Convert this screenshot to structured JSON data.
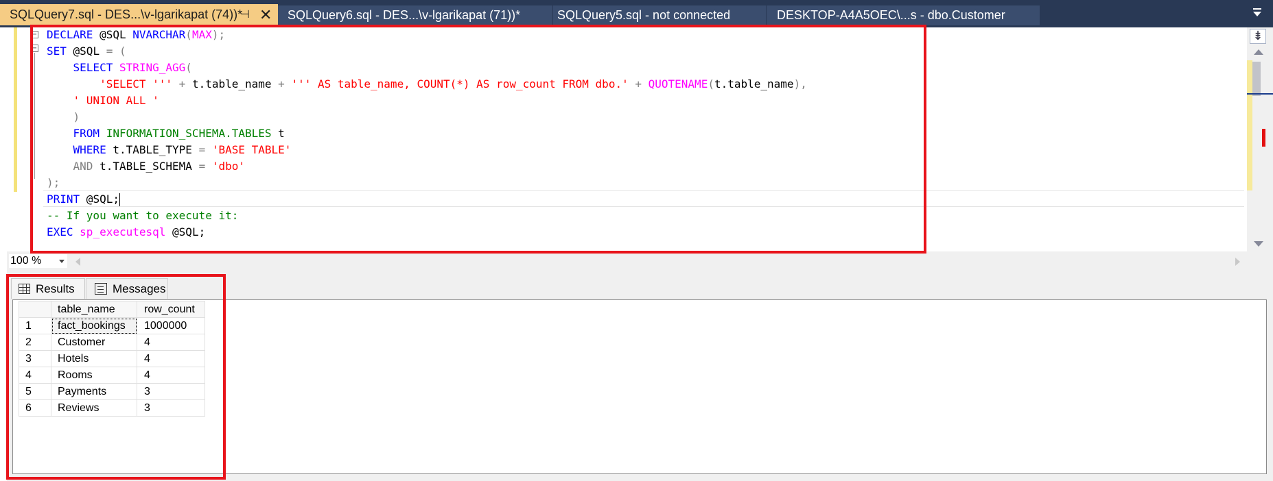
{
  "tabs": [
    {
      "label": "SQLQuery7.sql - DES...\\v-lgarikapat (74))*",
      "active": true
    },
    {
      "label": "SQLQuery6.sql - DES...\\v-lgarikapat (71))*",
      "active": false
    },
    {
      "label": "SQLQuery5.sql - not connected",
      "active": false
    },
    {
      "label": "DESKTOP-A4A5OEC\\...s - dbo.Customer",
      "active": false
    }
  ],
  "tab_icons": {
    "pin": "pin-icon",
    "close": "close-icon",
    "overflow": "tab-overflow-dropdown-icon"
  },
  "editor": {
    "lines": {
      "l1": {
        "kw1": "DECLARE",
        "var": " @SQL ",
        "kw2": "NVARCHAR",
        "p1": "(",
        "fn": "MAX",
        "p2": ");"
      },
      "l2": {
        "kw": "SET",
        "rest": " @SQL ",
        "op": "= ("
      },
      "l3": {
        "indent": "    ",
        "kw": "SELECT",
        "sp": " ",
        "fn": "STRING_AGG",
        "p": "("
      },
      "l4": {
        "indent": "        ",
        "s1": "'SELECT '''",
        "op1": " + ",
        "ident": "t.table_name",
        "op2": " + ",
        "s2": "''' AS table_name, COUNT(*) AS row_count FROM dbo.'",
        "op3": " + ",
        "fn": "QUOTENAME",
        "p1": "(",
        "arg": "t.table_name",
        "p2": "),"
      },
      "l5": {
        "indent": "    ",
        "s": "' UNION ALL '"
      },
      "l6": {
        "indent": "    ",
        "p": ")"
      },
      "l7": {
        "indent": "    ",
        "kw": "FROM",
        "sp": " ",
        "sys": "INFORMATION_SCHEMA.TABLES",
        "rest": " t"
      },
      "l8": {
        "indent": "    ",
        "kw": "WHERE",
        "rest": " t.TABLE_TYPE ",
        "op": "=",
        "sp": " ",
        "s": "'BASE TABLE'"
      },
      "l9": {
        "indent": "    ",
        "kw": "AND",
        "rest": " t.TABLE_SCHEMA ",
        "op": "=",
        "sp": " ",
        "s": "'dbo'"
      },
      "l10": {
        "p": ");"
      },
      "l11": {
        "kw": "PRINT",
        "rest": " @SQL;"
      },
      "l12": {
        "cmt": "-- If you want to execute it:"
      },
      "l13": {
        "kw": "EXEC",
        "sp": " ",
        "fn": "sp_executesql",
        "rest": " @SQL;"
      }
    }
  },
  "zoom": {
    "value": "100 %"
  },
  "results": {
    "tabs": {
      "results": "Results",
      "messages": "Messages"
    },
    "tab_icons": {
      "results": "grid-icon",
      "messages": "messages-icon"
    },
    "columns": [
      "table_name",
      "row_count"
    ],
    "rows": [
      {
        "n": "1",
        "table_name": "fact_bookings",
        "row_count": "1000000"
      },
      {
        "n": "2",
        "table_name": "Customer",
        "row_count": "4"
      },
      {
        "n": "3",
        "table_name": "Hotels",
        "row_count": "4"
      },
      {
        "n": "4",
        "table_name": "Rooms",
        "row_count": "4"
      },
      {
        "n": "5",
        "table_name": "Payments",
        "row_count": "3"
      },
      {
        "n": "6",
        "table_name": "Reviews",
        "row_count": "3"
      }
    ]
  },
  "colors": {
    "highlight_box": "#e8141b",
    "tab_strip": "#293955",
    "active_tab": "#f5cc84",
    "keyword": "#0000ff",
    "string": "#ff0000",
    "function": "#ff00ff",
    "comment": "#008000"
  }
}
